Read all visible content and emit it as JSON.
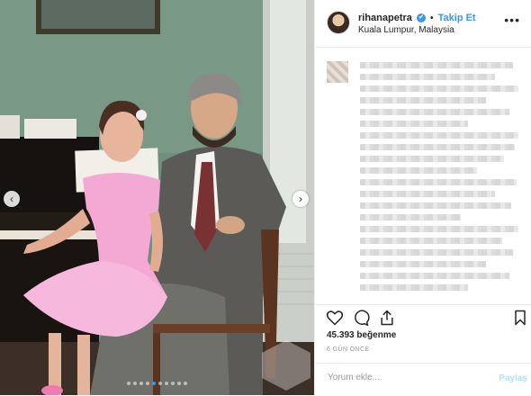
{
  "post": {
    "username": "rihanapetra",
    "verified_mark": "✔",
    "separator": "•",
    "follow_label": "Takip Et",
    "location": "Kuala Lumpur, Malaysia",
    "more_label": "•••",
    "likes_text": "45.393 beğenme",
    "timestamp": "6 GÜN ÖNCE",
    "comment_placeholder": "Yorum ekle...",
    "post_label": "Paylaş"
  },
  "carousel": {
    "prev_label": "‹",
    "next_label": "›",
    "slide_count": 10,
    "active_index": 4
  },
  "icons": {
    "like": "heart-icon",
    "comment": "comment-icon",
    "share": "share-icon",
    "save": "bookmark-icon"
  },
  "colors": {
    "accent": "#3897f0",
    "text": "#262626",
    "muted": "#999999",
    "divider": "#efefef",
    "post_disabled": "#b2dffc"
  }
}
